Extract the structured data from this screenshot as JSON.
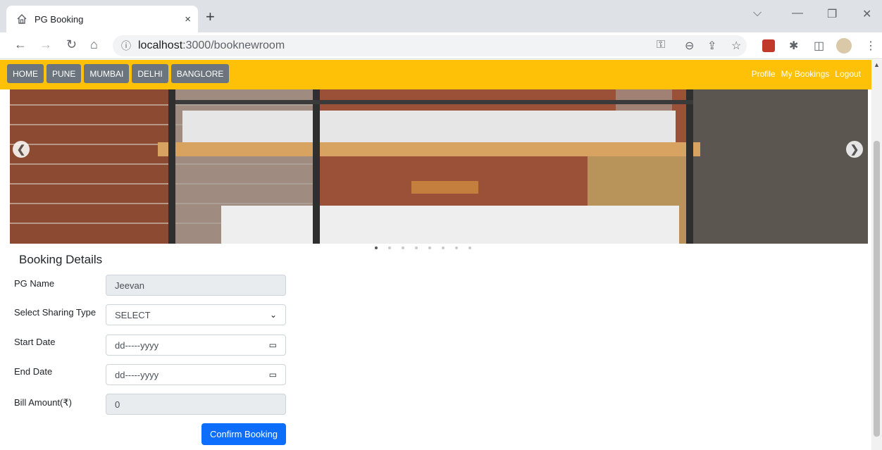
{
  "browser": {
    "tab_title": "PG Booking",
    "tab_close": "×",
    "new_tab": "+",
    "url_host": "localhost",
    "url_path": ":3000/booknewroom"
  },
  "nav": {
    "items": [
      "HOME",
      "PUNE",
      "MUMBAI",
      "DELHI",
      "BANGLORE"
    ],
    "right_links": [
      "Profile",
      "My Bookings",
      "Logout"
    ],
    "accent_color": "#ffc107"
  },
  "carousel": {
    "indicator_count": 8,
    "active_index": 0
  },
  "form": {
    "title": "Booking Details",
    "pg_name_label": "PG Name",
    "pg_name_value": "Jeevan",
    "sharing_label": "Select Sharing Type",
    "sharing_value": "SELECT",
    "start_label": "Start Date",
    "start_placeholder": "dd-----yyyy",
    "end_label": "End Date",
    "end_placeholder": "dd-----yyyy",
    "bill_label": "Bill Amount(₹)",
    "bill_value": "0",
    "confirm_label": "Confirm Booking",
    "confirm_color": "#0d6efd"
  }
}
